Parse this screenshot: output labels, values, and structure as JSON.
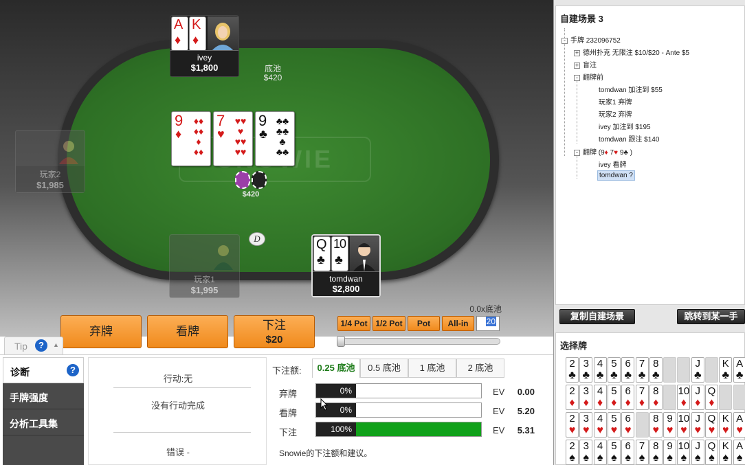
{
  "table": {
    "pot_label": "底池",
    "pot_amount": "$420",
    "chip_total": "$420",
    "logo_text": "SNOWIE",
    "dealer": "D",
    "board": [
      {
        "rank": "9",
        "suit": "♦",
        "color": "red"
      },
      {
        "rank": "7",
        "suit": "♥",
        "color": "red"
      },
      {
        "rank": "9",
        "suit": "♣",
        "color": "black"
      }
    ],
    "seats": {
      "ivey": {
        "name": "ivey",
        "stack": "$1,800",
        "cards": [
          {
            "rank": "A",
            "suit": "♦",
            "color": "red"
          },
          {
            "rank": "K",
            "suit": "♦",
            "color": "red"
          }
        ]
      },
      "p2": {
        "name": "玩家2",
        "stack": "$1,985"
      },
      "p1": {
        "name": "玩家1",
        "stack": "$1,995"
      },
      "hero": {
        "name": "tomdwan",
        "stack": "$2,800",
        "cards": [
          {
            "rank": "Q",
            "suit": "♣",
            "color": "black"
          },
          {
            "rank": "10",
            "suit": "♣",
            "color": "black"
          }
        ]
      }
    }
  },
  "actions": {
    "fold": "弃牌",
    "check": "看牌",
    "bet_label": "下注",
    "bet_amount": "$20",
    "quarter_pot": "1/4 Pot",
    "half_pot": "1/2 Pot",
    "pot": "Pot",
    "allin": "All-in",
    "bet_input": "20",
    "pot_ratio": "0.0x底池",
    "slider_fraction": 0
  },
  "tip": {
    "label": "Tip",
    "help": "?",
    "caret": "▲"
  },
  "nav": {
    "diagnosis": "诊断",
    "hand_strength": "手牌强度",
    "tools": "分析工具集",
    "help": "?"
  },
  "diagnosis": {
    "action": "行动:无",
    "complete": "没有行动完成",
    "error": "错误 -"
  },
  "bet_sizes": {
    "label": "下注额:",
    "tabs": [
      "0.25 底池",
      "0.5 底池",
      "1 底池",
      "2 底池"
    ],
    "active": 0
  },
  "advice": {
    "rows": [
      {
        "label": "弃牌",
        "pct": "0%",
        "fraction": 0,
        "ev_label": "EV",
        "ev": "0.00"
      },
      {
        "label": "看牌",
        "pct": "0%",
        "fraction": 0,
        "ev_label": "EV",
        "ev": "5.20"
      },
      {
        "label": "下注",
        "pct": "100%",
        "fraction": 1,
        "ev_label": "EV",
        "ev": "5.31"
      }
    ],
    "note": "Snowie的下注额和建议。"
  },
  "custom": {
    "title": "自建场景 3",
    "tree": [
      {
        "box": "-",
        "text": "手牌 232096752"
      },
      {
        "box": "+",
        "text": "德州扑克 无限注 $10/$20 - Ante $5"
      },
      {
        "box": "+",
        "text": "盲注"
      },
      {
        "box": "-",
        "text": "翻牌前"
      },
      {
        "box": "",
        "text": "tomdwan 加注到 $55"
      },
      {
        "box": "",
        "text": "玩家1 弃牌"
      },
      {
        "box": "",
        "text": "玩家2 弃牌"
      },
      {
        "box": "",
        "text": "ivey 加注到 $195"
      },
      {
        "box": "",
        "text": "tomdwan 跟注 $140"
      },
      {
        "box": "-",
        "text": "翻牌 (9",
        "flop_suffix": {
          "s1": "♦",
          "r2": " 7",
          "s2": "♥",
          "r3": " 9",
          "s3": "♣",
          "end": " )"
        }
      },
      {
        "box": "",
        "text": "ivey 看牌"
      },
      {
        "box": "",
        "text": "tomdwan ?"
      }
    ],
    "copy_btn": "复制自建场景",
    "jump_btn": "跳转到某一手"
  },
  "choose": {
    "title": "选择牌",
    "rows": [
      {
        "suit": "♣",
        "color": "black",
        "cards": [
          "2",
          "3",
          "4",
          "5",
          "6",
          "7",
          "8",
          "",
          "",
          "J",
          "",
          "K",
          "A"
        ]
      },
      {
        "suit": "♦",
        "color": "red",
        "cards": [
          "2",
          "3",
          "4",
          "5",
          "6",
          "7",
          "8",
          "",
          "10",
          "J",
          "Q",
          "",
          ""
        ]
      },
      {
        "suit": "♥",
        "color": "red",
        "cards": [
          "2",
          "3",
          "4",
          "5",
          "6",
          "",
          "8",
          "9",
          "10",
          "J",
          "Q",
          "K",
          "A"
        ]
      },
      {
        "suit": "♠",
        "color": "black",
        "cards": [
          "2",
          "3",
          "4",
          "5",
          "6",
          "7",
          "8",
          "9",
          "10",
          "J",
          "Q",
          "K",
          "A"
        ]
      }
    ]
  }
}
